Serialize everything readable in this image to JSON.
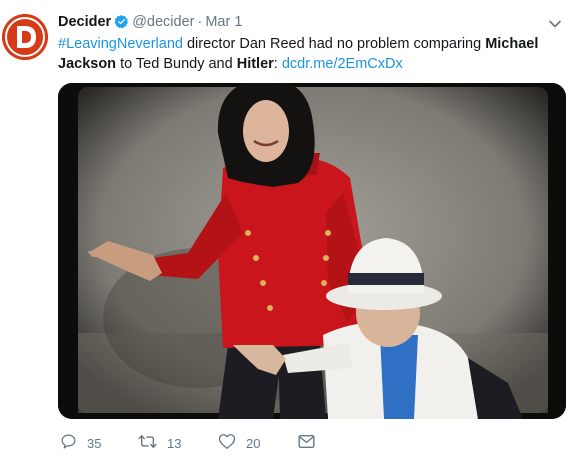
{
  "author": {
    "name": "Decider",
    "handle": "@decider",
    "separator": "·",
    "date": "Mar 1",
    "avatar_letter": "D",
    "brand_color": "#d63b17",
    "verified_color": "#1da1f2"
  },
  "tweet": {
    "hashtag": "#LeavingNeverland",
    "text_1": " director Dan Reed had no problem comparing ",
    "bold_1": "Michael Jackson",
    "text_2": " to Ted Bundy and ",
    "bold_2": "Hitler",
    "text_3": ": ",
    "link": "dcdr.me/2EmCxDx",
    "link_color": "#1b95e0"
  },
  "media": {
    "icon": "photo"
  },
  "actions": {
    "reply_count": "35",
    "retweet_count": "13",
    "like_count": "20",
    "icon_color": "#657786"
  }
}
